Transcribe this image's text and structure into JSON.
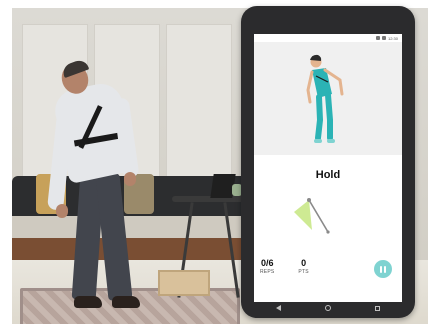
{
  "app": {
    "exercise_state": "Hold",
    "reps_value": "0/6",
    "reps_label": "REPS",
    "points_value": "0",
    "points_label": "PTS",
    "status_time": "12:30"
  },
  "icons": {
    "pause": "pause-icon",
    "back": "nav-back-icon",
    "home": "nav-home-icon",
    "recent": "nav-recent-icon"
  },
  "colors": {
    "accent": "#7fd3d1",
    "angle_wedge": "#c9e887",
    "avatar_shirt": "#2bb3b5",
    "device_frame": "#2b2b2d"
  }
}
